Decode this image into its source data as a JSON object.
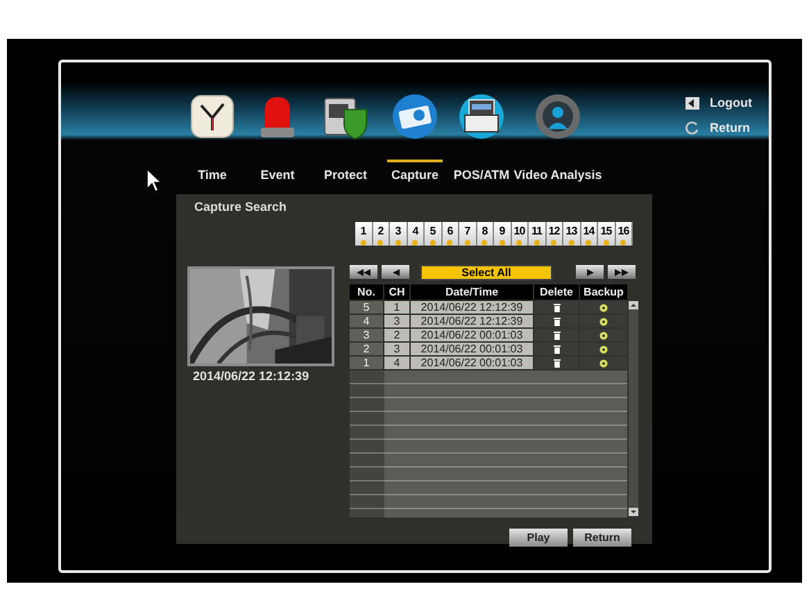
{
  "header": {
    "actions": [
      {
        "kind": "logout",
        "label": "Logout"
      },
      {
        "kind": "return",
        "label": "Return"
      }
    ]
  },
  "tabs": [
    {
      "kind": "clock",
      "label": "Time",
      "selected": false
    },
    {
      "kind": "siren",
      "label": "Event",
      "selected": false
    },
    {
      "kind": "shield",
      "label": "Protect",
      "selected": false
    },
    {
      "kind": "camera",
      "label": "Capture",
      "selected": true
    },
    {
      "kind": "register",
      "label": "POS/ATM",
      "selected": false
    },
    {
      "kind": "person",
      "label": "Video Analysis",
      "selected": false
    }
  ],
  "panel": {
    "title": "Capture Search",
    "channels": [
      {
        "label": "1",
        "selected": true
      },
      {
        "label": "2",
        "selected": true
      },
      {
        "label": "3",
        "selected": true
      },
      {
        "label": "4",
        "selected": true
      },
      {
        "label": "5",
        "selected": true
      },
      {
        "label": "6",
        "selected": true
      },
      {
        "label": "7",
        "selected": true
      },
      {
        "label": "8",
        "selected": true
      },
      {
        "label": "9",
        "selected": true
      },
      {
        "label": "10",
        "selected": true
      },
      {
        "label": "11",
        "selected": true
      },
      {
        "label": "12",
        "selected": true
      },
      {
        "label": "13",
        "selected": true
      },
      {
        "label": "14",
        "selected": true
      },
      {
        "label": "15",
        "selected": true
      },
      {
        "label": "16",
        "selected": true
      }
    ],
    "preview": {
      "timestamp": "2014/06/22 12:12:39"
    },
    "select_all": "Select All",
    "table": {
      "columns": [
        "No.",
        "CH",
        "Date/Time",
        "Delete",
        "Backup"
      ],
      "rows": [
        {
          "no": "5",
          "ch": "1",
          "datetime": "2014/06/22 12:12:39"
        },
        {
          "no": "4",
          "ch": "3",
          "datetime": "2014/06/22 12:12:39"
        },
        {
          "no": "3",
          "ch": "2",
          "datetime": "2014/06/22 00:01:03"
        },
        {
          "no": "2",
          "ch": "3",
          "datetime": "2014/06/22 00:01:03"
        },
        {
          "no": "1",
          "ch": "4",
          "datetime": "2014/06/22 00:01:03"
        }
      ]
    },
    "buttons": [
      "Play",
      "Return"
    ]
  }
}
